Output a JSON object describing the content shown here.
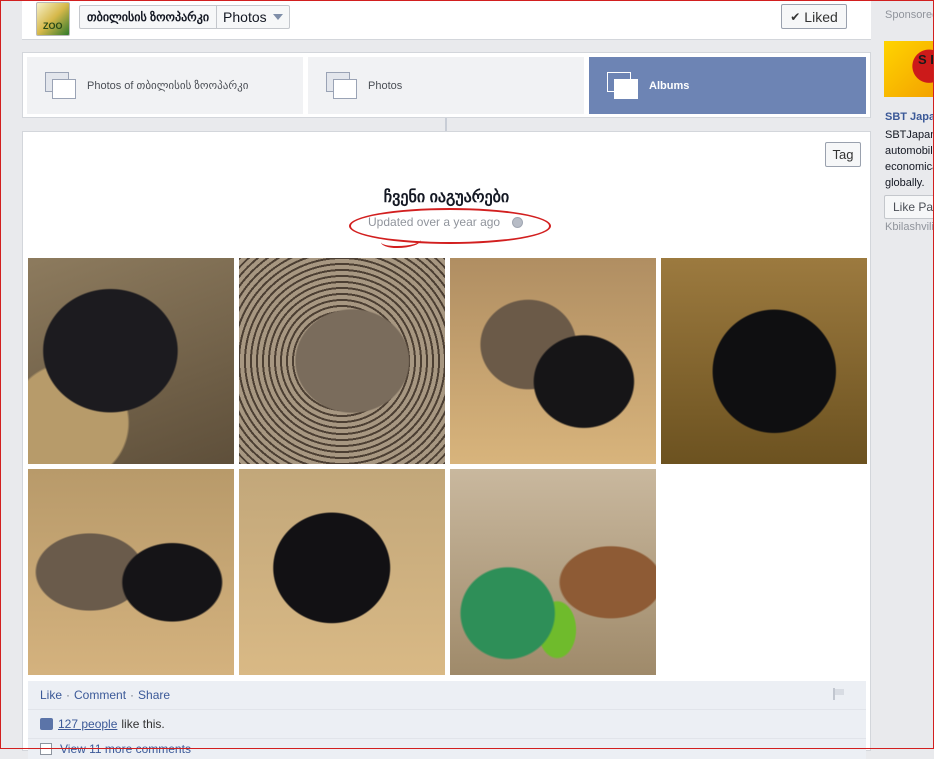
{
  "header": {
    "page_name": "თბილისის ზოოპარკი",
    "section": "Photos",
    "liked_label": "Liked",
    "logo_text": "ZOO"
  },
  "tabs": [
    {
      "label": "Photos of თბილისის ზოოპარკი",
      "active": false
    },
    {
      "label": "Photos",
      "active": false
    },
    {
      "label": "Albums",
      "active": true
    }
  ],
  "album": {
    "tag_label": "Tag",
    "title": "ჩვენი იაგუარები",
    "updated": "Updated over a year ago",
    "photos": [
      {
        "id": "p1"
      },
      {
        "id": "p2"
      },
      {
        "id": "p3"
      },
      {
        "id": "p4"
      },
      {
        "id": "p5"
      },
      {
        "id": "p6"
      },
      {
        "id": "p7"
      }
    ]
  },
  "feedback": {
    "like": "Like",
    "comment": "Comment",
    "share": "Share",
    "likes_people": "127 people",
    "likes_suffix": "like this.",
    "view_more": "View 11 more comments"
  },
  "sidebar": {
    "sponsored": "Sponsored",
    "ad_image_text": "S D",
    "ad_title": "SBT Japan",
    "ad_lines": [
      "SBTJapan",
      "automobile",
      "economical",
      "globally."
    ],
    "like_page": "Like Page",
    "ad_footer": "Kbilashvili"
  },
  "colors": {
    "accent": "#3b5998",
    "active_tab": "#6d84b4",
    "annotation": "#d21f1f"
  }
}
